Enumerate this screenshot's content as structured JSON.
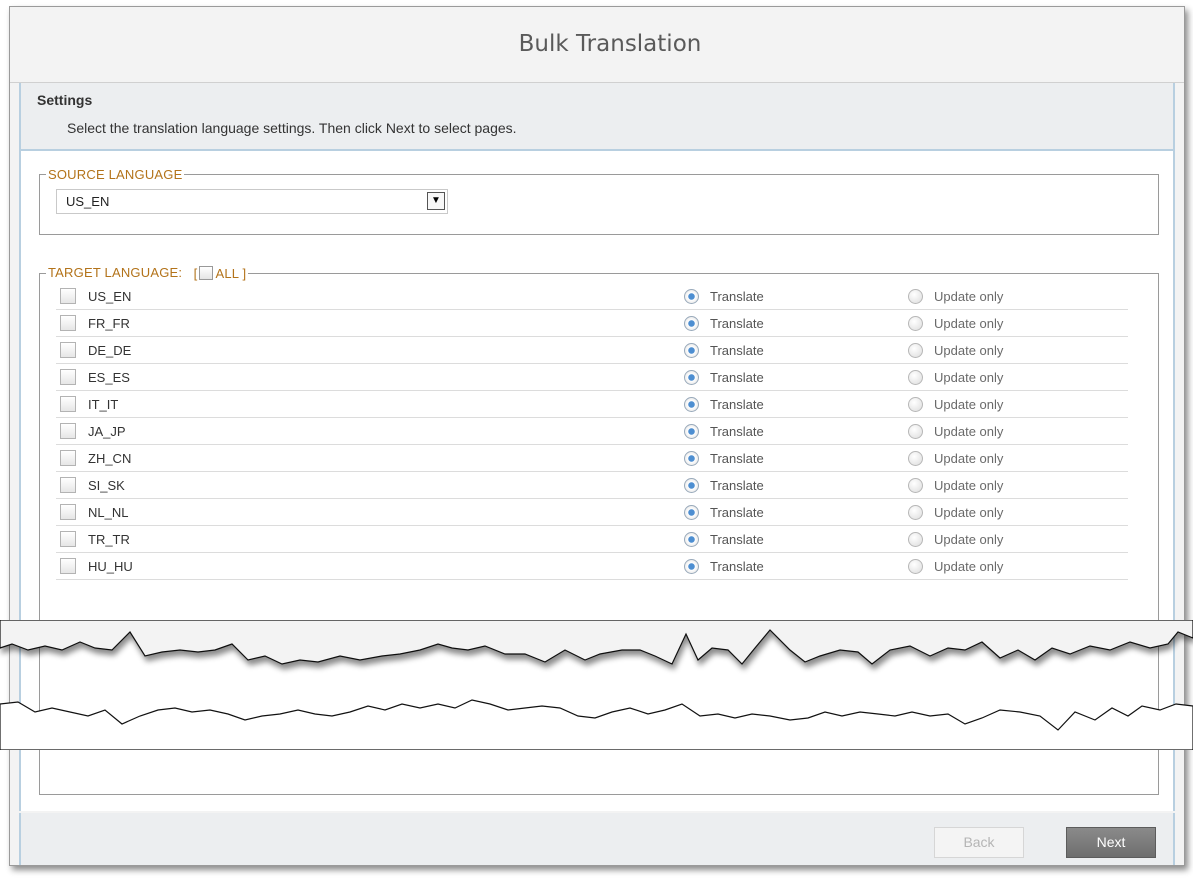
{
  "dialog": {
    "title": "Bulk Translation"
  },
  "settings": {
    "title": "Settings",
    "description": "Select the translation language settings. Then click Next to select pages."
  },
  "source": {
    "legend": "SOURCE LANGUAGE",
    "selected": "US_EN"
  },
  "target": {
    "legend": "TARGET LANGUAGE:",
    "all_open": "[",
    "all_label": "ALL ]",
    "translate_label": "Translate",
    "update_label": "Update only",
    "languages": [
      {
        "code": "US_EN",
        "checked": false,
        "mode": "Translate"
      },
      {
        "code": "FR_FR",
        "checked": false,
        "mode": "Translate"
      },
      {
        "code": "DE_DE",
        "checked": false,
        "mode": "Translate"
      },
      {
        "code": "ES_ES",
        "checked": false,
        "mode": "Translate"
      },
      {
        "code": "IT_IT",
        "checked": false,
        "mode": "Translate"
      },
      {
        "code": "JA_JP",
        "checked": false,
        "mode": "Translate"
      },
      {
        "code": "ZH_CN",
        "checked": false,
        "mode": "Translate"
      },
      {
        "code": "SI_SK",
        "checked": false,
        "mode": "Translate"
      },
      {
        "code": "NL_NL",
        "checked": false,
        "mode": "Translate"
      },
      {
        "code": "TR_TR",
        "checked": false,
        "mode": "Translate"
      },
      {
        "code": "HU_HU",
        "checked": false,
        "mode": "Translate"
      }
    ]
  },
  "footer": {
    "back_label": "Back",
    "next_label": "Next"
  },
  "colors": {
    "accent": "#b3731a",
    "radio_selected": "#4d8ed1",
    "panel_border": "#b8cfe0"
  },
  "icons": {
    "dropdown": "chevron-down-icon"
  }
}
